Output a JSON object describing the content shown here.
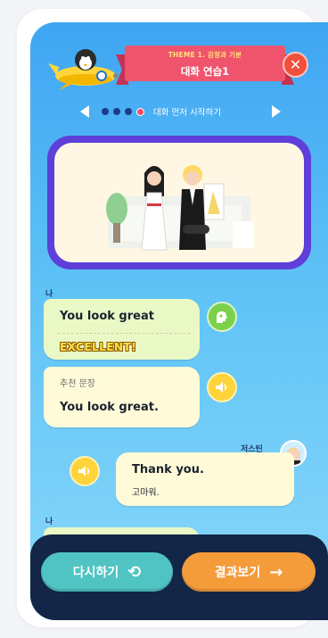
{
  "header": {
    "theme_label": "THEME 1. 감정과 기분",
    "lesson_title": "대화 연습1",
    "close_icon": "close-icon"
  },
  "steps": {
    "label": "대화 먼저 시작하기",
    "dots": 4,
    "active_index": 3
  },
  "chat": {
    "me_label": "나",
    "msg1": {
      "text": "You look great",
      "rating": "EXCELLENT!"
    },
    "rec": {
      "label": "추천 문장",
      "text": "You look great."
    },
    "partner_name": "저스틴",
    "msg2": {
      "text": "Thank you.",
      "translation": "고마워."
    },
    "me_label_2": "나"
  },
  "bottom": {
    "retry_label": "다시하기",
    "result_label": "결과보기"
  },
  "colors": {
    "accent_pink": "#f0546d",
    "retry": "#4fc4c3",
    "result": "#f49b3a",
    "bar": "#132647"
  }
}
